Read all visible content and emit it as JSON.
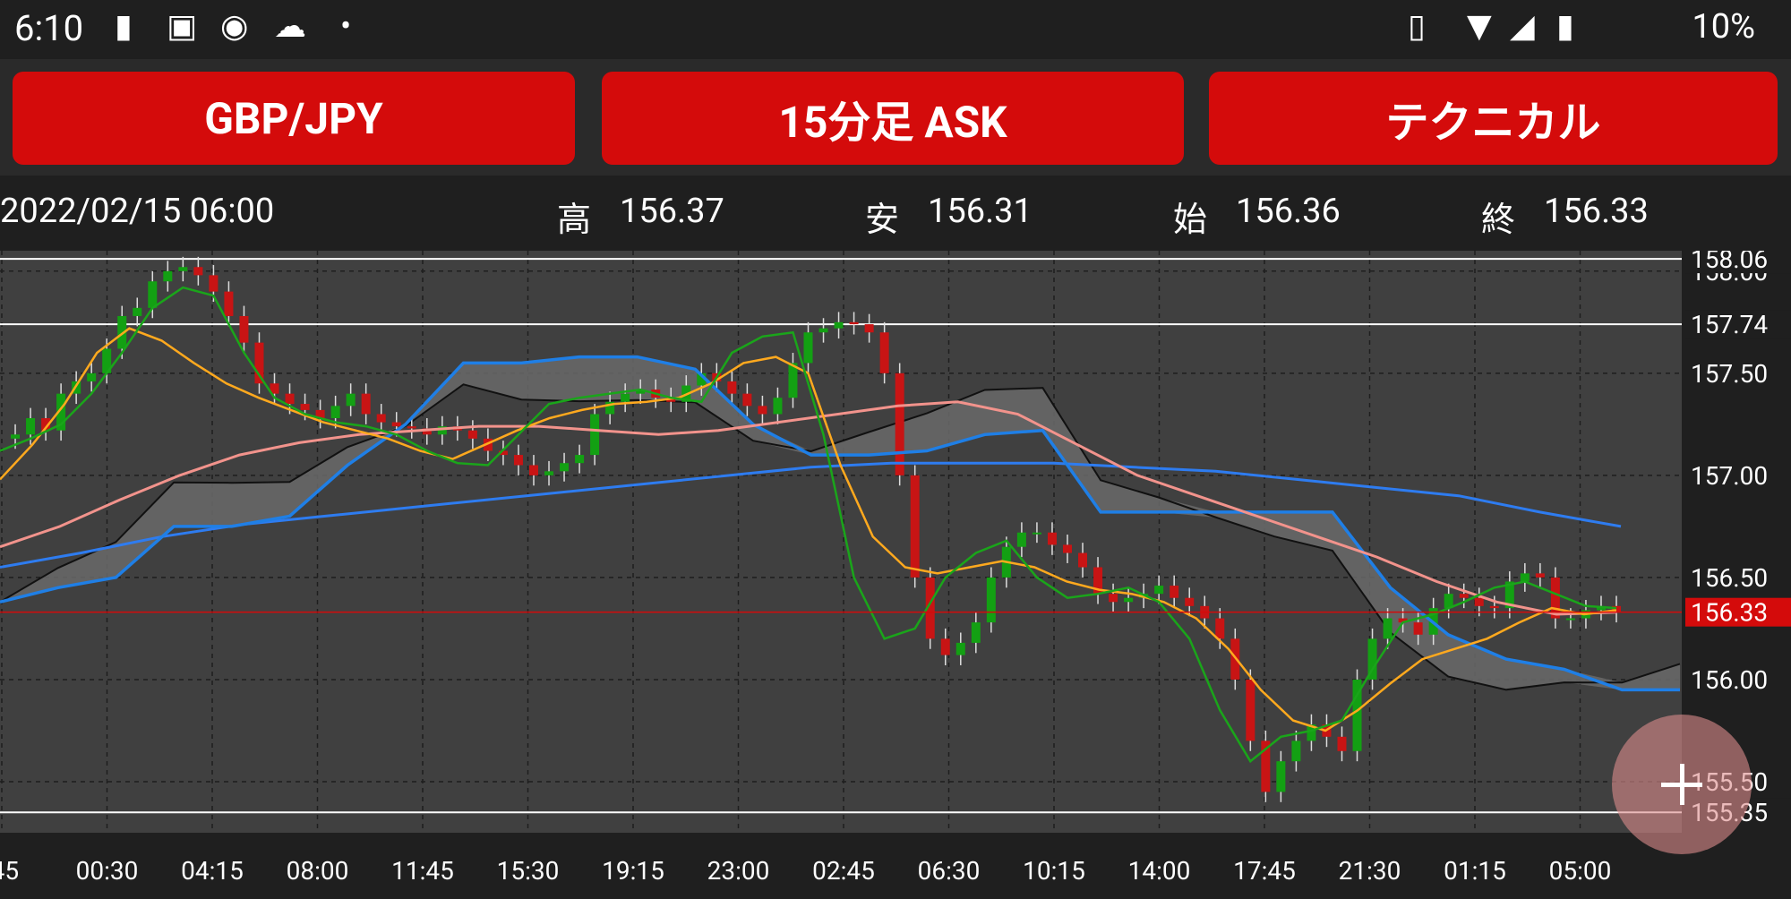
{
  "status_bar": {
    "time": "6:10",
    "battery": "10%",
    "icons": [
      "alert-icon",
      "image-icon",
      "line-app-icon",
      "weather-icon",
      "dot-icon"
    ],
    "right_icons": [
      "nfc-icon",
      "wifi-icon",
      "signal-icon",
      "battery-icon"
    ]
  },
  "toolbar": {
    "pair": "GBP/JPY",
    "timeframe": "15分足 ASK",
    "mode": "テクニカル"
  },
  "info": {
    "datetime": "2022/02/15 06:00",
    "high_label": "高",
    "high": "156.37",
    "low_label": "安",
    "low": "156.31",
    "open_label": "始",
    "open": "156.36",
    "close_label": "終",
    "close": "156.33"
  },
  "colors": {
    "button": "#d40b0b",
    "up": "#13a013",
    "down": "#c81414",
    "ma_fast": "#1aa51a",
    "ma_mid": "#ffa91e",
    "ma_slow": "#f2938c",
    "ma_long": "#2e7cf0",
    "kijun": "#1f7fe6",
    "current_line": "#d40b0b",
    "cloud": "#6a6a6a"
  },
  "chart_data": {
    "type": "line",
    "title": "GBP/JPY 15分足 ASK",
    "x_ticks": [
      ":45",
      "00:30",
      "04:15",
      "08:00",
      "11:45",
      "15:30",
      "19:15",
      "23:00",
      "02:45",
      "06:30",
      "10:15",
      "14:00",
      "17:45",
      "21:30",
      "01:15",
      "05:00"
    ],
    "y_ticks": [
      "158.00",
      "157.50",
      "157.00",
      "156.50",
      "156.00",
      "155.50"
    ],
    "ylim": [
      155.25,
      158.1
    ],
    "marked_levels": [
      158.06,
      157.74,
      155.35
    ],
    "marked_labels": [
      "158.06",
      "157.74",
      "155.35"
    ],
    "current_price": 156.33,
    "current_label": "156.33",
    "grid": true,
    "series": [
      {
        "name": "price",
        "values": [
          157.18,
          157.2,
          157.28,
          157.22,
          157.4,
          157.46,
          157.5,
          157.62,
          157.78,
          157.82,
          157.95,
          158.0,
          158.02,
          157.98,
          157.9,
          157.78,
          157.65,
          157.45,
          157.4,
          157.35,
          157.32,
          157.28,
          157.34,
          157.4,
          157.3,
          157.26,
          157.24,
          157.23,
          157.2,
          157.24,
          157.22,
          157.18,
          157.12,
          157.1,
          157.05,
          157.0,
          157.02,
          157.06,
          157.1,
          157.3,
          157.36,
          157.4,
          157.42,
          157.38,
          157.36,
          157.44,
          157.5,
          157.46,
          157.4,
          157.34,
          157.3,
          157.38,
          157.55,
          157.7,
          157.72,
          157.75,
          157.74,
          157.7,
          157.5,
          157.0,
          156.5,
          156.2,
          156.12,
          156.18,
          156.28,
          156.5,
          156.65,
          156.72,
          156.72,
          156.66,
          156.62,
          156.55,
          156.42,
          156.38,
          156.4,
          156.42,
          156.46,
          156.4,
          156.36,
          156.3,
          156.2,
          156.0,
          155.7,
          155.45,
          155.6,
          155.7,
          155.78,
          155.72,
          155.65,
          156.0,
          156.2,
          156.3,
          156.28,
          156.22,
          156.35,
          156.42,
          156.4,
          156.36,
          156.35,
          156.48,
          156.52,
          156.5,
          156.3,
          156.3,
          156.34,
          156.36,
          156.33
        ]
      },
      {
        "name": "ma_fast",
        "values": [
          157.12,
          157.18,
          157.25,
          157.4,
          157.6,
          157.82,
          157.92,
          157.88,
          157.6,
          157.38,
          157.3,
          157.26,
          157.24,
          157.2,
          157.12,
          157.06,
          157.05,
          157.2,
          157.35,
          157.38,
          157.4,
          157.42,
          157.38,
          157.36,
          157.6,
          157.68,
          157.7,
          157.2,
          156.5,
          156.2,
          156.25,
          156.5,
          156.62,
          156.68,
          156.5,
          156.4,
          156.42,
          156.45,
          156.38,
          156.2,
          155.85,
          155.6,
          155.72,
          155.75,
          155.8,
          156.05,
          156.28,
          156.32,
          156.38,
          156.45,
          156.48,
          156.42,
          156.36,
          156.35
        ]
      },
      {
        "name": "ma_mid",
        "values": [
          156.98,
          157.15,
          157.35,
          157.6,
          157.72,
          157.66,
          157.55,
          157.45,
          157.38,
          157.32,
          157.26,
          157.22,
          157.18,
          157.12,
          157.08,
          157.15,
          157.22,
          157.28,
          157.32,
          157.35,
          157.36,
          157.38,
          157.45,
          157.55,
          157.58,
          157.5,
          157.05,
          156.7,
          156.55,
          156.52,
          156.55,
          156.58,
          156.55,
          156.48,
          156.44,
          156.42,
          156.38,
          156.3,
          156.15,
          155.95,
          155.8,
          155.75,
          155.85,
          155.98,
          156.1,
          156.15,
          156.2,
          156.28,
          156.35,
          156.32,
          156.34
        ]
      },
      {
        "name": "ma_slow",
        "values": [
          156.65,
          156.75,
          156.88,
          157.0,
          157.1,
          157.16,
          157.2,
          157.22,
          157.24,
          157.24,
          157.22,
          157.2,
          157.22,
          157.26,
          157.3,
          157.34,
          157.36,
          157.3,
          157.15,
          157.0,
          156.9,
          156.8,
          156.7,
          156.6,
          156.48,
          156.38,
          156.32,
          156.33
        ]
      },
      {
        "name": "ma_long",
        "values": [
          156.55,
          156.62,
          156.7,
          156.76,
          156.8,
          156.84,
          156.88,
          156.92,
          156.96,
          157.0,
          157.04,
          157.06,
          157.06,
          157.06,
          157.04,
          157.02,
          156.98,
          156.94,
          156.9,
          156.82,
          156.75
        ]
      },
      {
        "name": "kijun",
        "values": [
          156.38,
          156.45,
          156.5,
          156.75,
          156.75,
          156.8,
          157.05,
          157.25,
          157.55,
          157.55,
          157.58,
          157.58,
          157.52,
          157.25,
          157.1,
          157.1,
          157.12,
          157.2,
          157.22,
          156.82,
          156.82,
          156.82,
          156.82,
          156.82,
          156.45,
          156.22,
          156.1,
          156.05,
          155.95,
          155.95
        ]
      }
    ]
  }
}
